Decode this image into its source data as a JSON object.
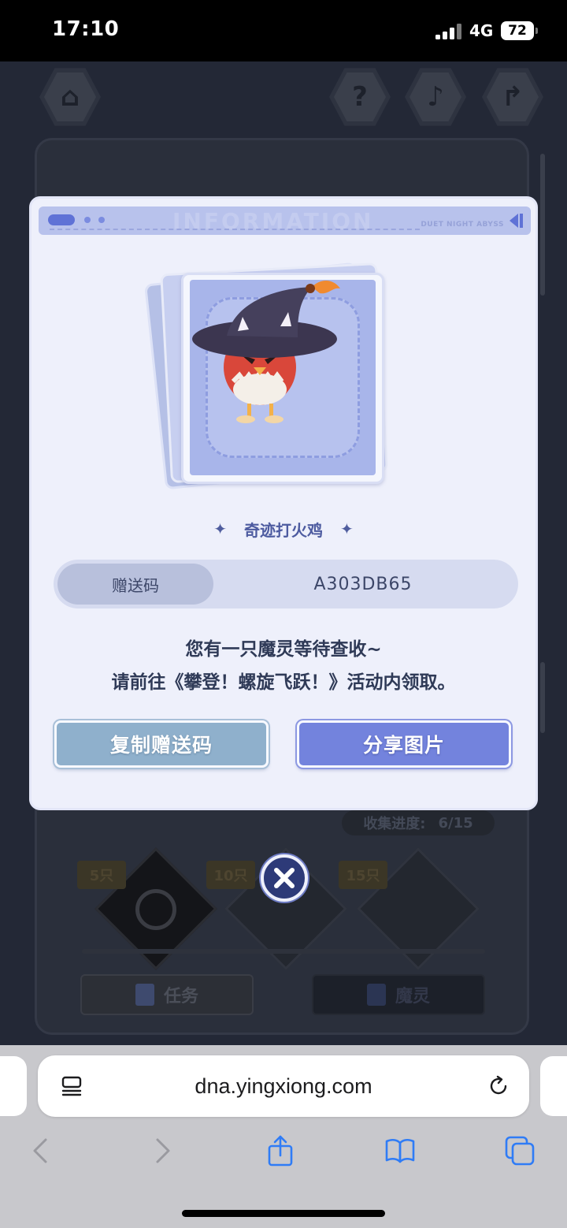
{
  "status_bar": {
    "time": "17:10",
    "network": "4G",
    "battery": "72"
  },
  "game": {
    "progress_label": "收集进度:",
    "progress_value": "6/15",
    "rewards": [
      {
        "label": "5只"
      },
      {
        "label": "10只"
      },
      {
        "label": "15只"
      }
    ],
    "tabs": [
      {
        "label": "任务"
      },
      {
        "label": "魔灵"
      }
    ]
  },
  "modal": {
    "brand": "DUET NIGHT ABYSS",
    "watermark": "INFORMATION",
    "spirit_name": "奇迹打火鸡",
    "code_label": "赠送码",
    "code_value": "A303DB65",
    "message_line1": "您有一只魔灵等待查收~",
    "message_line2": "请前往《攀登！螺旋飞跃！》活动内领取。",
    "copy_button": "复制赠送码",
    "share_button": "分享图片"
  },
  "browser": {
    "url": "dna.yingxiong.com"
  },
  "colors": {
    "modal_bg": "#eef0fb",
    "accent": "#7383dd",
    "copy_button": "#8fb0cc",
    "close_button": "#2d3a78"
  },
  "icons": {
    "home": "home-icon",
    "help": "question-icon",
    "music": "music-note-icon",
    "share": "share-arrow-icon",
    "close": "close-icon",
    "reader": "reader-mode-icon",
    "reload": "reload-icon",
    "back": "chevron-left-icon",
    "forward": "chevron-right-icon",
    "share_sheet": "share-icon",
    "bookmarks": "book-icon",
    "tabs": "tabs-icon"
  }
}
